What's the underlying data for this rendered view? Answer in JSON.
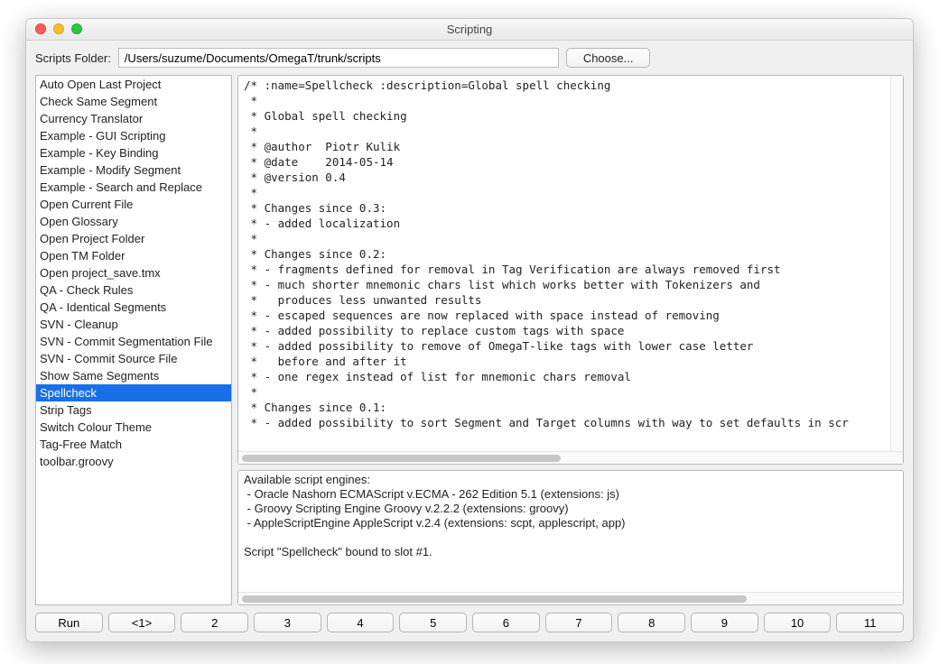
{
  "window": {
    "title": "Scripting"
  },
  "toolbar": {
    "folder_label": "Scripts Folder:",
    "folder_path": "/Users/suzume/Documents/OmegaT/trunk/scripts",
    "choose_label": "Choose..."
  },
  "scriptList": {
    "selected_index": 16,
    "items": [
      "Auto Open Last Project",
      "Check Same Segment",
      "Currency Translator",
      "Example - GUI Scripting",
      "Example - Key Binding",
      "Example - Modify Segment",
      "Example - Search and Replace",
      "Open Current File",
      "Open Glossary",
      "Open Project Folder",
      "Open TM Folder",
      "Open project_save.tmx",
      "QA - Check Rules",
      "QA - Identical Segments",
      "SVN - Cleanup",
      "SVN - Commit Segmentation File",
      "SVN - Commit Source File",
      "Show Same Segments",
      "Spellcheck",
      "Strip Tags",
      "Switch Colour Theme",
      "Tag-Free Match",
      "toolbar.groovy"
    ]
  },
  "code": "/* :name=Spellcheck :description=Global spell checking\n * \n * Global spell checking\n * \n * @author  Piotr Kulik\n * @date    2014-05-14\n * @version 0.4\n *\n * Changes since 0.3:\n * - added localization\n *\n * Changes since 0.2:\n * - fragments defined for removal in Tag Verification are always removed first\n * - much shorter mnemonic chars list which works better with Tokenizers and\n *   produces less unwanted results\n * - escaped sequences are now replaced with space instead of removing\n * - added possibility to replace custom tags with space\n * - added possibility to remove of OmegaT-like tags with lower case letter\n *   before and after it\n * - one regex instead of list for mnemonic chars removal\n *\n * Changes since 0.1:\n * - added possibility to sort Segment and Target columns with way to set defaults in scr",
  "output": "Available script engines:\n - Oracle Nashorn ECMAScript v.ECMA - 262 Edition 5.1 (extensions: js)\n - Groovy Scripting Engine Groovy v.2.2.2 (extensions: groovy)\n - AppleScriptEngine AppleScript v.2.4 (extensions: scpt, applescript, app)\n\nScript \"Spellcheck\" bound to slot #1.",
  "buttons": {
    "run": "Run",
    "slots": [
      "<1>",
      "2",
      "3",
      "4",
      "5",
      "6",
      "7",
      "8",
      "9",
      "10",
      "11"
    ]
  }
}
